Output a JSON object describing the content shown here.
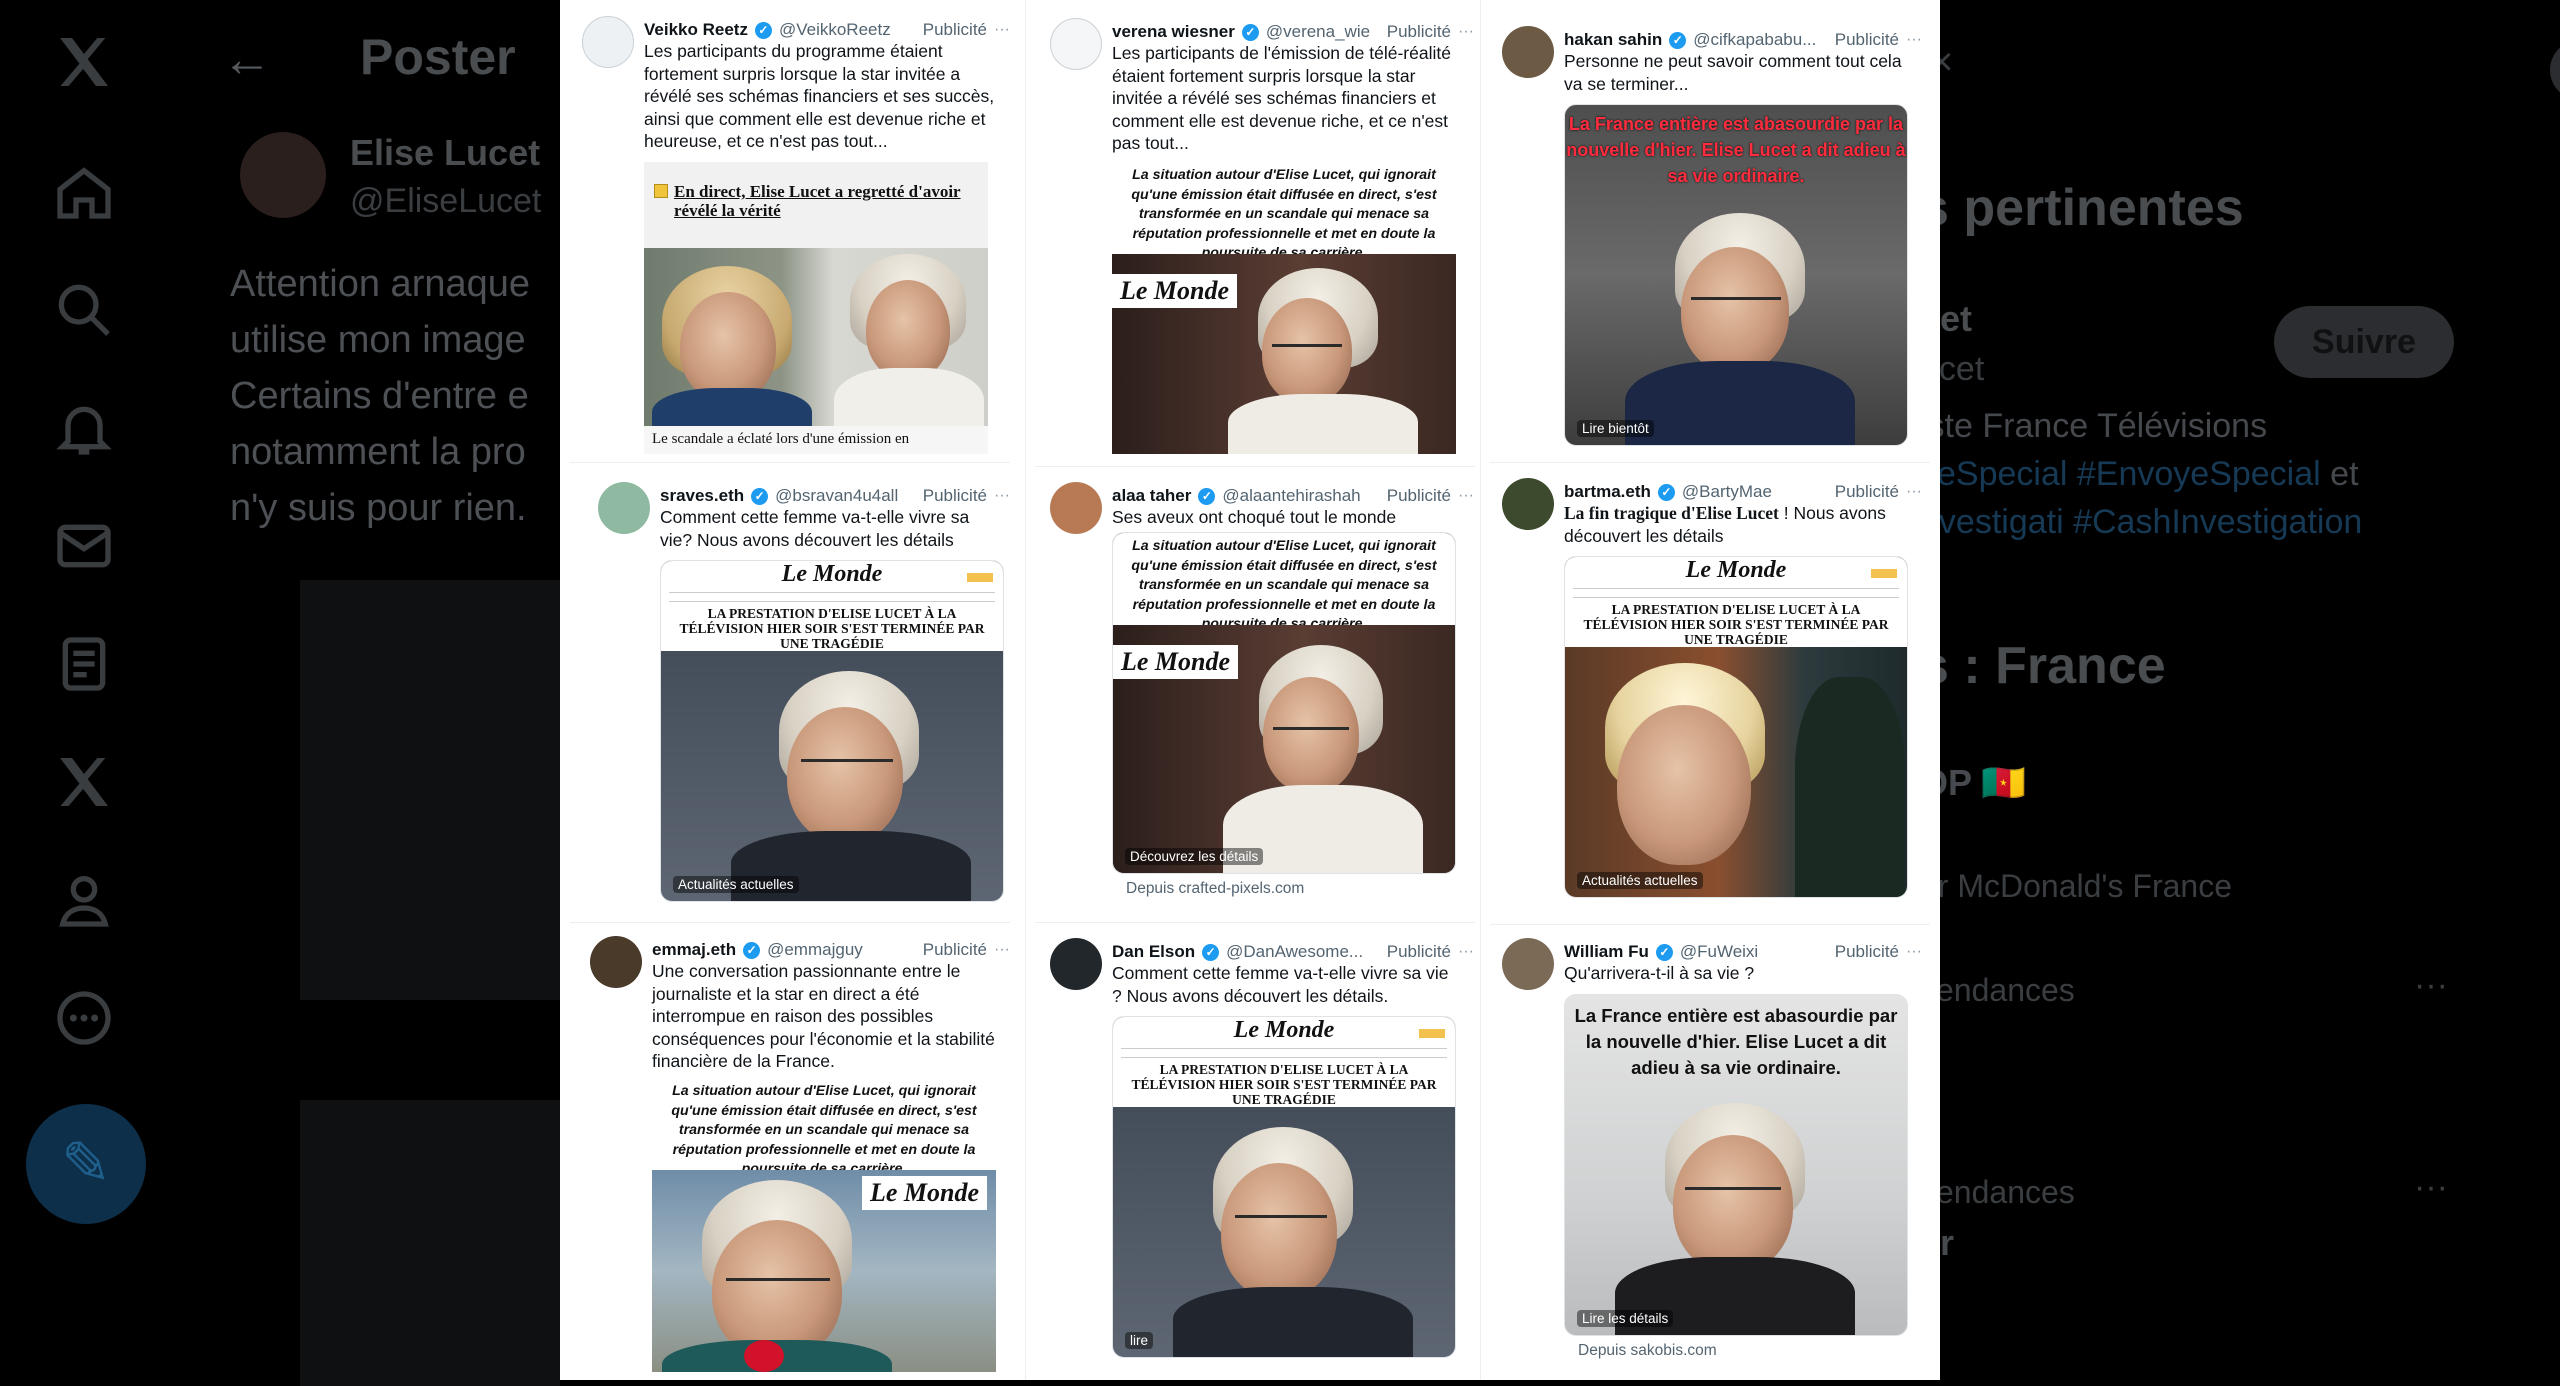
{
  "background": {
    "title": "Poster",
    "author_name": "Elise Lucet",
    "author_handle": "@EliseLucet",
    "post_text": "Attention arnaque\nutilise mon image\nCertains d'entre e\nnotamment la pro\nn'y suis pour rien.",
    "right_heading": "s pertinentes",
    "right_name": "cet",
    "right_handle": "ucet",
    "follow_label": "Suivre",
    "bio_line1": "iste France Télévisions",
    "bio_line2_tag1": "yeSpecial",
    "bio_line2_tag2": "#EnvoyeSpecial",
    "bio_line2_tail": "et",
    "bio_line3": "nvestigati #CashInvestigation",
    "trends_heading": "s : France",
    "trend1": "OP 🇨🇲",
    "trend2": "ar McDonald's France",
    "trend3": "Tendances",
    "trend4": "Tendances",
    "trend5": "er"
  },
  "tweets": [
    {
      "name": "Veikko Reetz",
      "handle": "@VeikkoReetz",
      "ad_label": "Publicité",
      "text": "Les participants du programme étaient fortement surpris lorsque la star invitée a révélé ses schémas financiers et ses succès, ainsi que comment elle est devenue riche et heureuse, et ce n'est pas tout...",
      "media_title": "En direct, Elise Lucet a regretté d'avoir révélé la vérité",
      "media_footer": "Le scandale a éclaté lors d'une émission en"
    },
    {
      "name": "verena wiesner",
      "handle": "@verena_wie",
      "ad_label": "Publicité",
      "text": "Les participants de l'émission de télé-réalité étaient fortement surpris lorsque la star invitée a révélé ses schémas financiers et comment elle est devenue riche, et ce n'est pas tout...",
      "media_caption": "La situation autour d'Elise Lucet, qui ignorait qu'une émission était diffusée en direct, s'est transformée en un scandale qui menace sa réputation professionnelle et met en doute la poursuite de sa carrière.",
      "media_stamp": "Le Monde"
    },
    {
      "name": "hakan sahin",
      "handle": "@cifkapababu...",
      "ad_label": "Publicité",
      "text": "Personne ne peut savoir comment tout cela va se terminer...",
      "media_headline": "La France entière est abasourdie par la nouvelle d'hier. Elise Lucet a dit adieu à sa vie ordinaire.",
      "media_label": "Lire bientôt"
    },
    {
      "name": "sraves.eth",
      "handle": "@bsravan4u4all",
      "ad_label": "Publicité",
      "text": "Comment cette femme va-t-elle vivre sa vie? Nous avons découvert les détails",
      "media_logo": "Le Monde",
      "media_headline": "La prestation d'Elise Lucet à la télévision hier soir s'est terminée par une tragédie",
      "media_label": "Actualités actuelles"
    },
    {
      "name": "alaa taher",
      "handle": "@alaantehirashah",
      "ad_label": "Publicité",
      "text": "Ses aveux ont choqué tout le monde",
      "media_caption": "La situation autour d'Elise Lucet, qui ignorait qu'une émission était diffusée en direct, s'est transformée en un scandale qui menace sa réputation professionnelle et met en doute la poursuite de sa carrière.",
      "media_stamp": "Le Monde",
      "media_label": "Découvrez les détails",
      "source": "Depuis crafted-pixels.com"
    },
    {
      "name": "bartma.eth",
      "handle": "@BartyMae",
      "ad_label": "Publicité",
      "text_bold": "La fin tragique d'Elise Lucet",
      "text": " ! Nous avons découvert les détails",
      "media_logo": "Le Monde",
      "media_headline": "La prestation d'Elise Lucet à la télévision hier soir s'est terminée par une tragédie",
      "media_label": "Actualités actuelles"
    },
    {
      "name": "emmaj.eth",
      "handle": "@emmajguy",
      "ad_label": "Publicité",
      "text": "Une conversation passionnante entre le journaliste et la star en direct a été interrompue en raison des possibles conséquences pour l'économie et la stabilité financière de la France.",
      "media_caption": "La situation autour d'Elise Lucet, qui ignorait qu'une émission était diffusée en direct, s'est transformée en un scandale qui menace sa réputation professionnelle et met en doute la poursuite de sa carrière.",
      "media_stamp": "Le Monde"
    },
    {
      "name": "Dan Elson",
      "handle": "@DanAwesome...",
      "ad_label": "Publicité",
      "text": "Comment cette femme va-t-elle vivre sa vie ? Nous avons découvert les détails.",
      "media_logo": "Le Monde",
      "media_headline": "La prestation d'Elise Lucet à la télévision hier soir s'est terminée par une tragédie",
      "media_label": "lire"
    },
    {
      "name": "William Fu",
      "handle": "@FuWeixi",
      "ad_label": "Publicité",
      "text": "Qu'arrivera-t-il à sa vie ?",
      "media_headline": "La France entière est abasourdie par la nouvelle d'hier. Elise Lucet a dit adieu à sa vie ordinaire.",
      "media_label": "Lire les détails",
      "source": "Depuis sakobis.com"
    }
  ],
  "colors": {
    "verified": "#1d9bf0",
    "headline_red": "#e0102a",
    "text": "#0f1419",
    "muted": "#536471"
  }
}
